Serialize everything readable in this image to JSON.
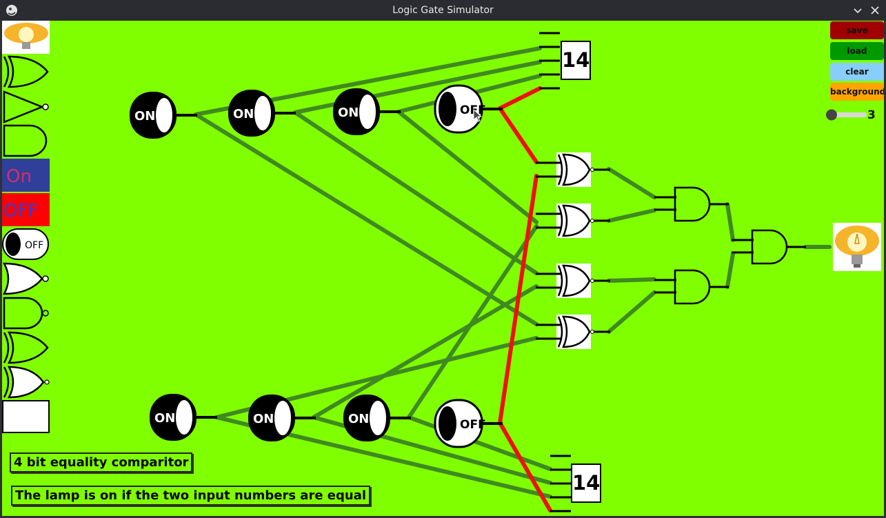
{
  "window": {
    "title": "Logic Gate Simulator"
  },
  "palette": {
    "items": [
      {
        "name": "lamp"
      },
      {
        "name": "xor-gate"
      },
      {
        "name": "not-gate"
      },
      {
        "name": "and-gate"
      },
      {
        "name": "on-source"
      },
      {
        "name": "off-source"
      },
      {
        "name": "switch"
      },
      {
        "name": "nor-gate"
      },
      {
        "name": "nand-gate"
      },
      {
        "name": "or-gate"
      },
      {
        "name": "xnor-gate"
      },
      {
        "name": "display"
      }
    ]
  },
  "buttons": {
    "save": {
      "label": "save",
      "color": "#a00000"
    },
    "load": {
      "label": "load",
      "color": "#009900"
    },
    "clear": {
      "label": "clear",
      "color": "#87cefa"
    },
    "background": {
      "label": "background",
      "color": "#ffa500"
    }
  },
  "slider": {
    "value": "3"
  },
  "circuit": {
    "switches_top": [
      "ON",
      "ON",
      "ON",
      "OFF"
    ],
    "switches_bottom": [
      "ON",
      "ON",
      "ON",
      "OFF"
    ],
    "display_top": "14",
    "display_bottom": "14",
    "wire_on_color": "#3f8a20",
    "wire_off_color": "#ee1111"
  },
  "labels": {
    "title": "4 bit equality comparitor",
    "description": "The lamp is on if the two input numbers are equal"
  }
}
